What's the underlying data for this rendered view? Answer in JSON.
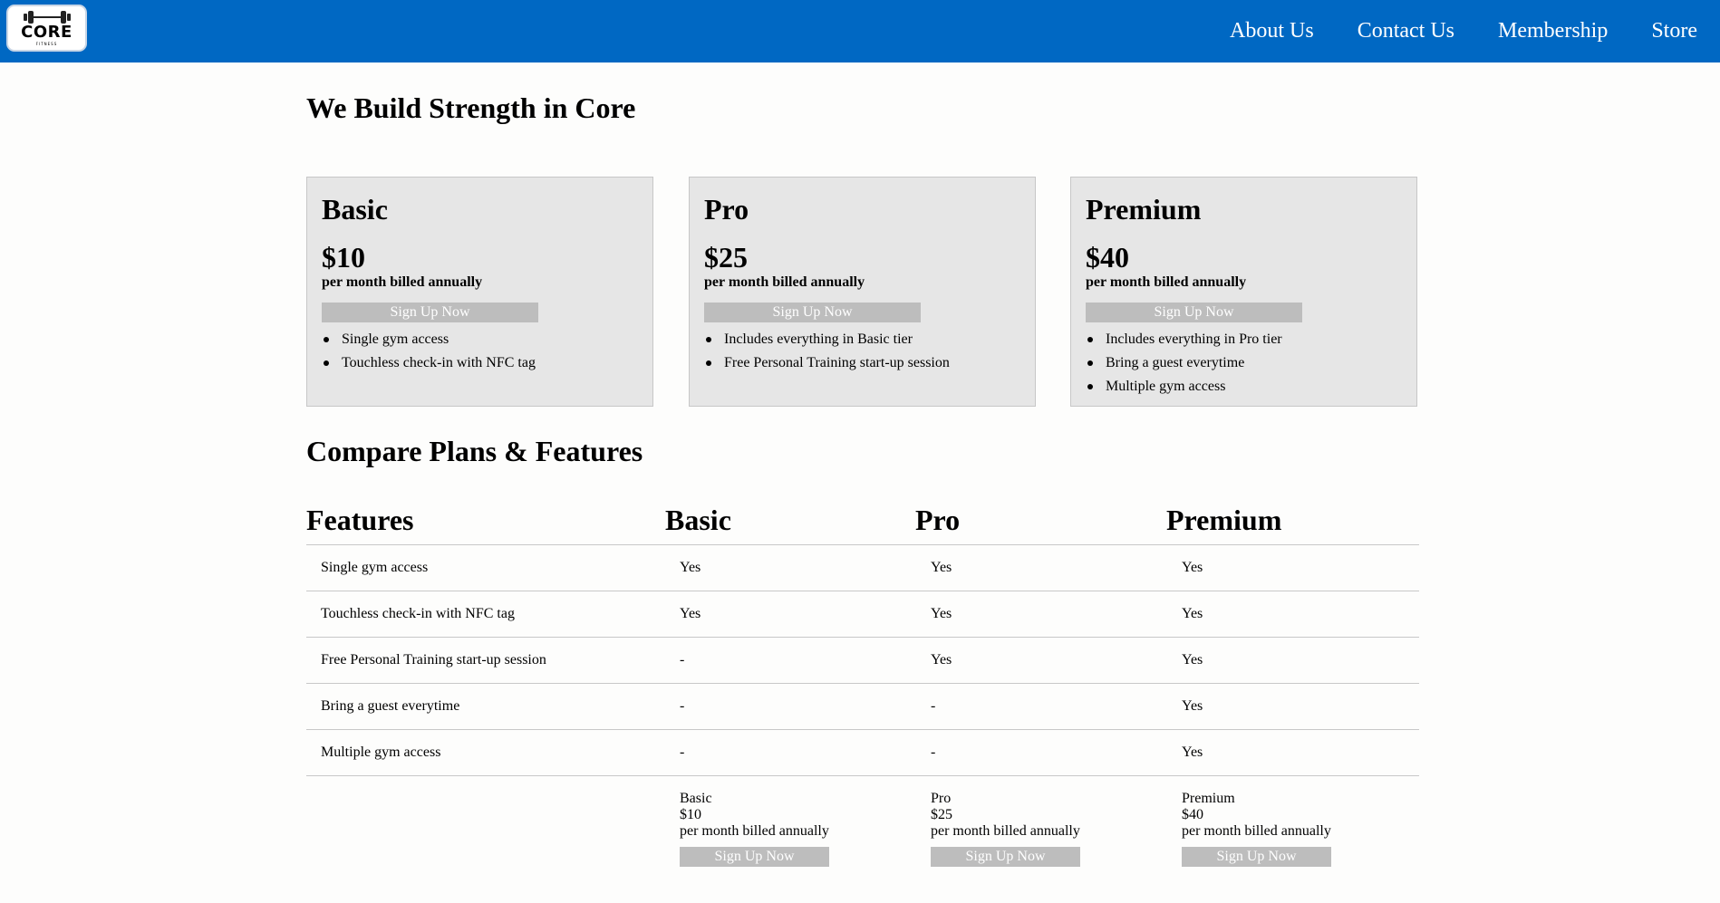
{
  "nav": {
    "logo": {
      "brand": "CORE",
      "tagline": "FITNESS",
      "icon": "dumbbell-icon"
    },
    "links": [
      "About Us",
      "Contact Us",
      "Membership",
      "Store"
    ]
  },
  "hero": {
    "title": "We Build Strength in Core"
  },
  "plans": [
    {
      "name": "Basic",
      "price": "$10",
      "billing": "per month billed annually",
      "cta": "Sign Up Now",
      "features": [
        "Single gym access",
        "Touchless check-in with NFC tag"
      ]
    },
    {
      "name": "Pro",
      "price": "$25",
      "billing": "per month billed annually",
      "cta": "Sign Up Now",
      "features": [
        "Includes everything in Basic tier",
        "Free Personal Training start-up session"
      ]
    },
    {
      "name": "Premium",
      "price": "$40",
      "billing": "per month billed annually",
      "cta": "Sign Up Now",
      "features": [
        "Includes everything in Pro tier",
        "Bring a guest everytime",
        "Multiple gym access"
      ]
    }
  ],
  "compare": {
    "title": "Compare Plans & Features",
    "headers": [
      "Features",
      "Basic",
      "Pro",
      "Premium"
    ],
    "rows": [
      [
        "Single gym access",
        "Yes",
        "Yes",
        "Yes"
      ],
      [
        "Touchless check-in with NFC tag",
        "Yes",
        "Yes",
        "Yes"
      ],
      [
        "Free Personal Training start-up session",
        "-",
        "Yes",
        "Yes"
      ],
      [
        "Bring a guest everytime",
        "-",
        "-",
        "Yes"
      ],
      [
        "Multiple gym access",
        "-",
        "-",
        "Yes"
      ]
    ],
    "footer": [
      {
        "name": "Basic",
        "price": "$10",
        "billing": "per month billed annually",
        "cta": "Sign Up Now"
      },
      {
        "name": "Pro",
        "price": "$25",
        "billing": "per month billed annually",
        "cta": "Sign Up Now"
      },
      {
        "name": "Premium",
        "price": "$40",
        "billing": "per month billed annually",
        "cta": "Sign Up Now"
      }
    ]
  },
  "colors": {
    "navbar": "#0068c3",
    "card_bg": "#e6e6e6",
    "button_bg": "#bdbdbd"
  }
}
